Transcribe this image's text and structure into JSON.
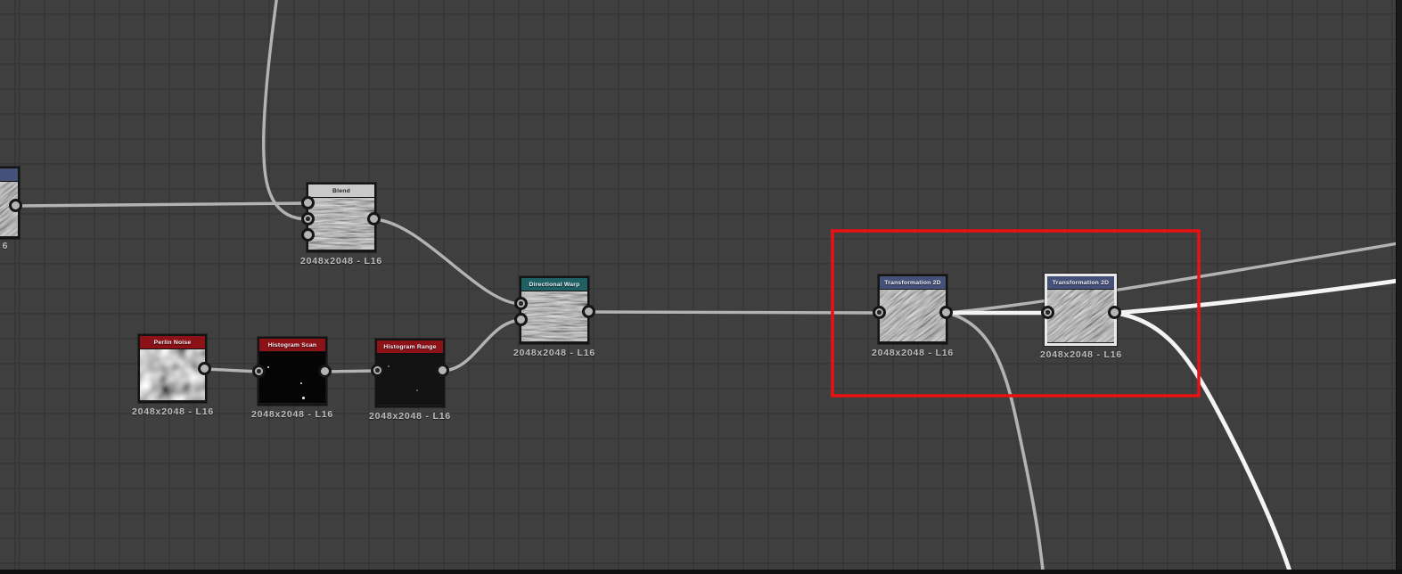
{
  "app": {
    "name": "node-graph-editor",
    "background_color": "#3f3f3f",
    "grid_line_color": "#363636"
  },
  "colors": {
    "wire_normal": "#b3b3b3",
    "wire_highlight": "#f4f4f4",
    "annotation_red": "#ec1111",
    "node_border": "#141414",
    "node_border_selected": "#e9e9e9",
    "header_blend": "#c9c9c9",
    "header_directional_warp": "#1e6064",
    "header_noise_red": "#8d1217",
    "header_transformation_blue": "#46517a",
    "port_fill": "#b5b5b5",
    "label_text": "#bdbdbd"
  },
  "nodes": [
    {
      "id": "partial-left-node",
      "title": "",
      "label": "6",
      "selected": false
    },
    {
      "id": "blend",
      "title": "Blend",
      "label": "2048x2048 - L16",
      "selected": false
    },
    {
      "id": "directional-warp",
      "title": "Directional Warp",
      "label": "2048x2048 - L16",
      "selected": false
    },
    {
      "id": "perlin-noise",
      "title": "Perlin Noise",
      "label": "2048x2048 - L16",
      "selected": false
    },
    {
      "id": "histogram-scan",
      "title": "Histogram Scan",
      "label": "2048x2048 - L16",
      "selected": false
    },
    {
      "id": "histogram-range",
      "title": "Histogram Range",
      "label": "2048x2048 - L16",
      "selected": false
    },
    {
      "id": "transformation-2d-1",
      "title": "Transformation 2D",
      "label": "2048x2048 - L16",
      "selected": false
    },
    {
      "id": "transformation-2d-2",
      "title": "Transformation 2D",
      "label": "2048x2048 - L16",
      "selected": true
    }
  ],
  "annotation": {
    "type": "red-rectangle",
    "encloses": [
      "transformation-2d-1",
      "transformation-2d-2"
    ]
  }
}
